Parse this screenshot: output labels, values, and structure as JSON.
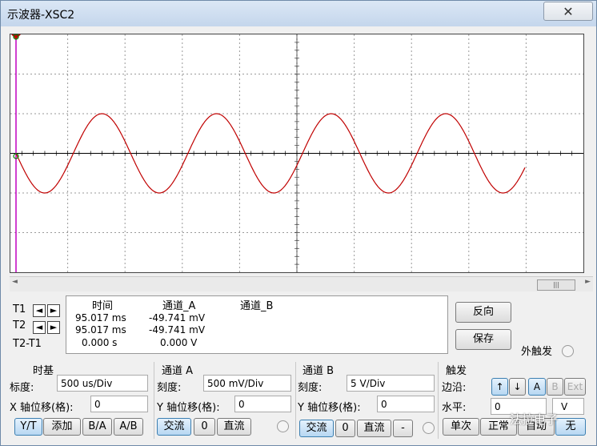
{
  "window": {
    "title": "示波器-XSC2",
    "close_glyph": "✕"
  },
  "scope": {
    "trace_color": "#c00000",
    "grid_color": "#9a9a9a",
    "cursor_color": "#c000c0",
    "cursor_t2_color": "#008000"
  },
  "scrollbar": {
    "left_arrow": "◄",
    "right_arrow": "►",
    "thumb_grip": "|||"
  },
  "cursors": {
    "t1_label": "T1",
    "t2_label": "T2",
    "t2t1_label": "T2-T1",
    "left_glyph": "◄",
    "right_glyph": "►"
  },
  "readout": {
    "headers": {
      "time": "时间",
      "channel_a": "通道_A",
      "channel_b": "通道_B"
    },
    "rows": [
      {
        "time": "95.017 ms",
        "channel_a": "-49.741 mV",
        "channel_b": ""
      },
      {
        "time": "95.017 ms",
        "channel_a": "-49.741 mV",
        "channel_b": ""
      },
      {
        "time": "0.000 s",
        "channel_a": "0.000 V",
        "channel_b": ""
      }
    ]
  },
  "side_buttons": {
    "reverse": "反向",
    "save": "保存",
    "ext_trigger": "外触发"
  },
  "timebase": {
    "heading": "时基",
    "scale_label": "标度:",
    "scale_value": "500 us/Div",
    "xpos_label": "X 轴位移(格):",
    "xpos_value": "0",
    "modes": [
      "Y/T",
      "添加",
      "B/A",
      "A/B"
    ]
  },
  "channel_a": {
    "heading": "通道 A",
    "scale_label": "刻度:",
    "scale_value": "500 mV/Div",
    "ypos_label": "Y 轴位移(格):",
    "ypos_value": "0",
    "coupling": [
      "交流",
      "0",
      "直流"
    ]
  },
  "channel_b": {
    "heading": "通道 B",
    "scale_label": "刻度:",
    "scale_value": "5  V/Div",
    "ypos_label": "Y 轴位移(格):",
    "ypos_value": "0",
    "coupling": [
      "交流",
      "0",
      "直流",
      "-"
    ]
  },
  "trigger": {
    "heading": "触发",
    "edge_label": "边沿:",
    "edge_rise": "↑",
    "edge_fall": "↓",
    "sources": [
      "A",
      "B",
      "Ext"
    ],
    "level_label": "水平:",
    "level_value": "0",
    "level_unit": "V",
    "modes": [
      "单次",
      "正常",
      "自动",
      "无"
    ]
  },
  "watermark": "法拉电子"
}
